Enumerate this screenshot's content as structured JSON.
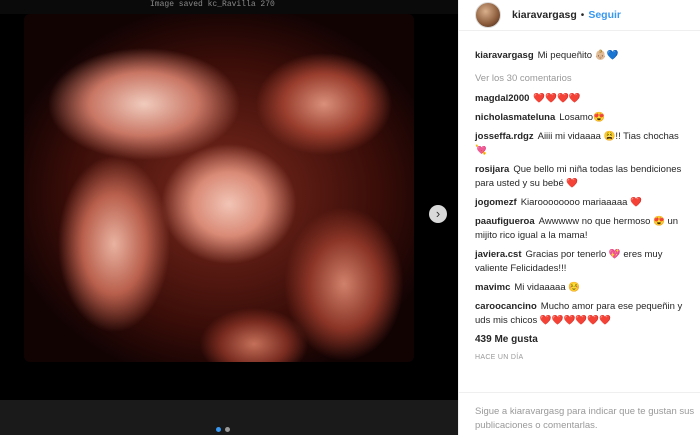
{
  "media": {
    "caption_strip": "Image saved    kc_Ravilla 270",
    "next_label": "›"
  },
  "header": {
    "username": "kiaravargasg",
    "separator": "•",
    "follow_label": "Seguir"
  },
  "caption": {
    "username": "kiaravargasg",
    "text": "Mi pequeñito 👶🏼💙"
  },
  "view_comments": "Ver los 30 comentarios",
  "comments": [
    {
      "username": "magdal2000",
      "text": "❤️❤️❤️❤️"
    },
    {
      "username": "nicholasmateluna",
      "text": "Losamo😍"
    },
    {
      "username": "josseffa.rdgz",
      "text": "Aiiii mi vidaaaa 😩!! Tias chochas 💘"
    },
    {
      "username": "rosijara",
      "text": "Que bello mi niña todas las bendiciones para usted y su bebé ❤️"
    },
    {
      "username": "jogomezf",
      "text": "Kiaroooooooo mariaaaaa ❤️"
    },
    {
      "username": "paaufigueroa",
      "text": "Awwwww no que hermoso 😍 un mijito rico igual a la mama!"
    },
    {
      "username": "javiera.cst",
      "text": "Gracias por tenerlo 💖 eres muy valiente Felicidades!!!"
    },
    {
      "username": "mavimc",
      "text": "Mi vidaaaaa ☺️"
    },
    {
      "username": "caroocancino",
      "text": "Mucho amor para ese pequeñin y uds mis chicos ❤️❤️❤️❤️❤️❤️"
    }
  ],
  "likes": "439 Me gusta",
  "time_ago": "HACE UN DÍA",
  "login_prompt": "Sigue a kiaravargasg para indicar que te gustan sus publicaciones o comentarlas."
}
